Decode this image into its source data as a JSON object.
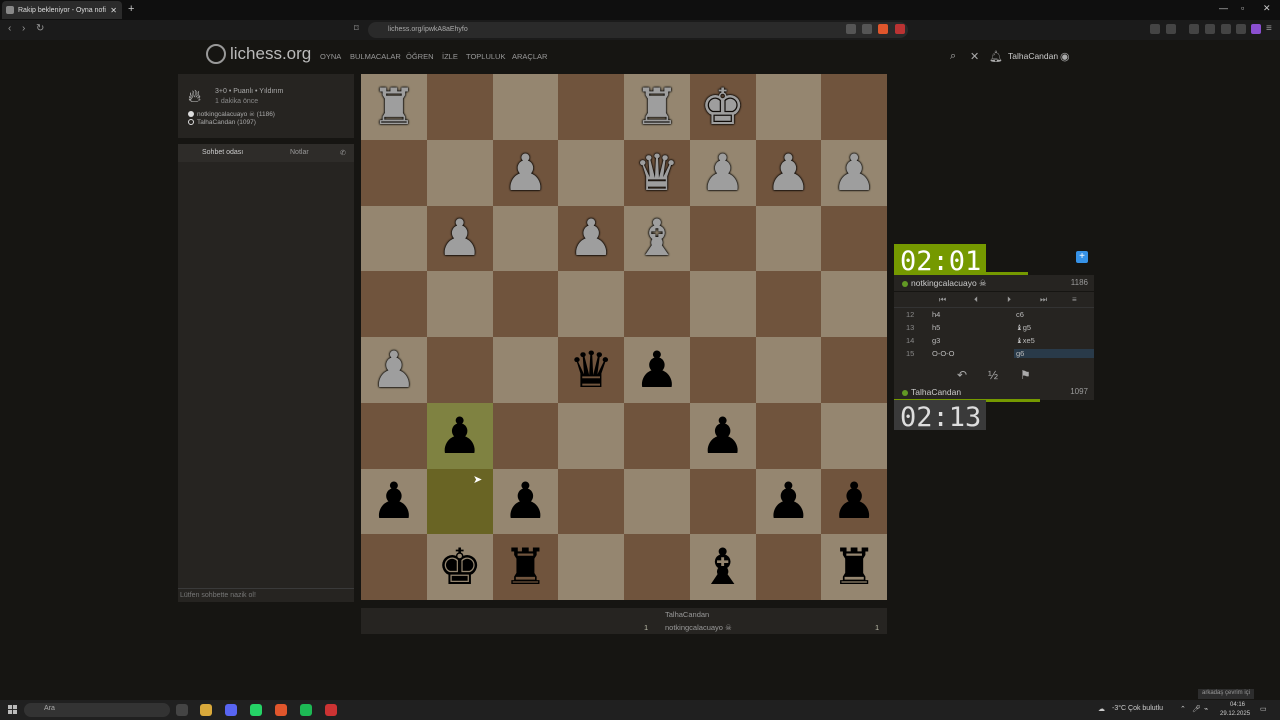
{
  "browser": {
    "tab_title": "Rakip bekleniyor - Oyna nofi",
    "new_tab_label": "+",
    "url": "lichess.org/ipwkA8aEhyfo"
  },
  "header": {
    "logo_text": "lichess.org",
    "nav": [
      "OYNA",
      "BULMACALAR",
      "ÖĞREN",
      "İZLE",
      "TOPLULUK",
      "ARAÇLAR"
    ],
    "username": "TalhaCandan"
  },
  "game_info": {
    "mode": "3+0 • Puanlı • Yıldırım",
    "time_ago": "1 dakika önce",
    "players": [
      {
        "name": "notkingcalacuayo ☠ (1186)",
        "color": "white"
      },
      {
        "name": "TalhaCandan (1097)",
        "color": "black"
      }
    ]
  },
  "chat": {
    "tab_chat": "Sohbet odası",
    "tab_notes": "Notlar",
    "input_placeholder": "Lütfen sohbette nazik ol!"
  },
  "board": {
    "highlight_squares": [
      "b3",
      "b2"
    ],
    "pieces": [
      {
        "sq": "a8",
        "glyph": "♜",
        "side": "w"
      },
      {
        "sq": "e8",
        "glyph": "♜",
        "side": "w"
      },
      {
        "sq": "f8",
        "glyph": "♚",
        "side": "w"
      },
      {
        "sq": "c7",
        "glyph": "♟",
        "side": "w"
      },
      {
        "sq": "e7",
        "glyph": "♛",
        "side": "w"
      },
      {
        "sq": "f7",
        "glyph": "♟",
        "side": "w"
      },
      {
        "sq": "g7",
        "glyph": "♟",
        "side": "w"
      },
      {
        "sq": "h7",
        "glyph": "♟",
        "side": "w"
      },
      {
        "sq": "b6",
        "glyph": "♟",
        "side": "w"
      },
      {
        "sq": "d6",
        "glyph": "♟",
        "side": "w"
      },
      {
        "sq": "e6",
        "glyph": "♝",
        "side": "w"
      },
      {
        "sq": "a4",
        "glyph": "♟",
        "side": "w"
      },
      {
        "sq": "d4",
        "glyph": "♛",
        "side": "b"
      },
      {
        "sq": "e4",
        "glyph": "♟",
        "side": "b"
      },
      {
        "sq": "b3",
        "glyph": "♟",
        "side": "b"
      },
      {
        "sq": "f3",
        "glyph": "♟",
        "side": "b"
      },
      {
        "sq": "a2",
        "glyph": "♟",
        "side": "b"
      },
      {
        "sq": "c2",
        "glyph": "♟",
        "side": "b"
      },
      {
        "sq": "g2",
        "glyph": "♟",
        "side": "b"
      },
      {
        "sq": "h2",
        "glyph": "♟",
        "side": "b"
      },
      {
        "sq": "b1",
        "glyph": "♚",
        "side": "b"
      },
      {
        "sq": "c1",
        "glyph": "♜",
        "side": "b"
      },
      {
        "sq": "f1",
        "glyph": "♝",
        "side": "b"
      },
      {
        "sq": "h1",
        "glyph": "♜",
        "side": "b"
      }
    ]
  },
  "clocks": {
    "top": "02:01",
    "bottom": "02:13",
    "top_fraction": 0.67,
    "bottom_fraction": 0.73
  },
  "players": {
    "top": {
      "name": "notkingcalacuayo ☠",
      "rating": "1186"
    },
    "bottom": {
      "name": "TalhaCandan",
      "rating": "1097"
    }
  },
  "moves": [
    {
      "num": "12",
      "w": "h4",
      "b": "c6"
    },
    {
      "num": "13",
      "w": "h5",
      "b": "♝g5"
    },
    {
      "num": "14",
      "w": "g3",
      "b": "♝xe5"
    },
    {
      "num": "15",
      "w": "O-O-O",
      "b": "g6"
    }
  ],
  "actions": {
    "takeback": "↶",
    "draw": "½",
    "resign": "⚑"
  },
  "crosstable": {
    "top_name": "TalhaCandan",
    "bottom_name": "notkingcalacuayo ☠",
    "score_left": "1",
    "score_right": "1"
  },
  "taskbar": {
    "search_placeholder": "Ara",
    "weather": "-3°C  Çok bulutlu",
    "time": "04:16",
    "date": "29.12.2025",
    "toast": "arkadaş çevrim içi"
  },
  "colors": {
    "board_light": "#f0d9b5",
    "board_dark": "#b58863",
    "clock_active": "#759900",
    "accent_blue": "#3692e7"
  }
}
